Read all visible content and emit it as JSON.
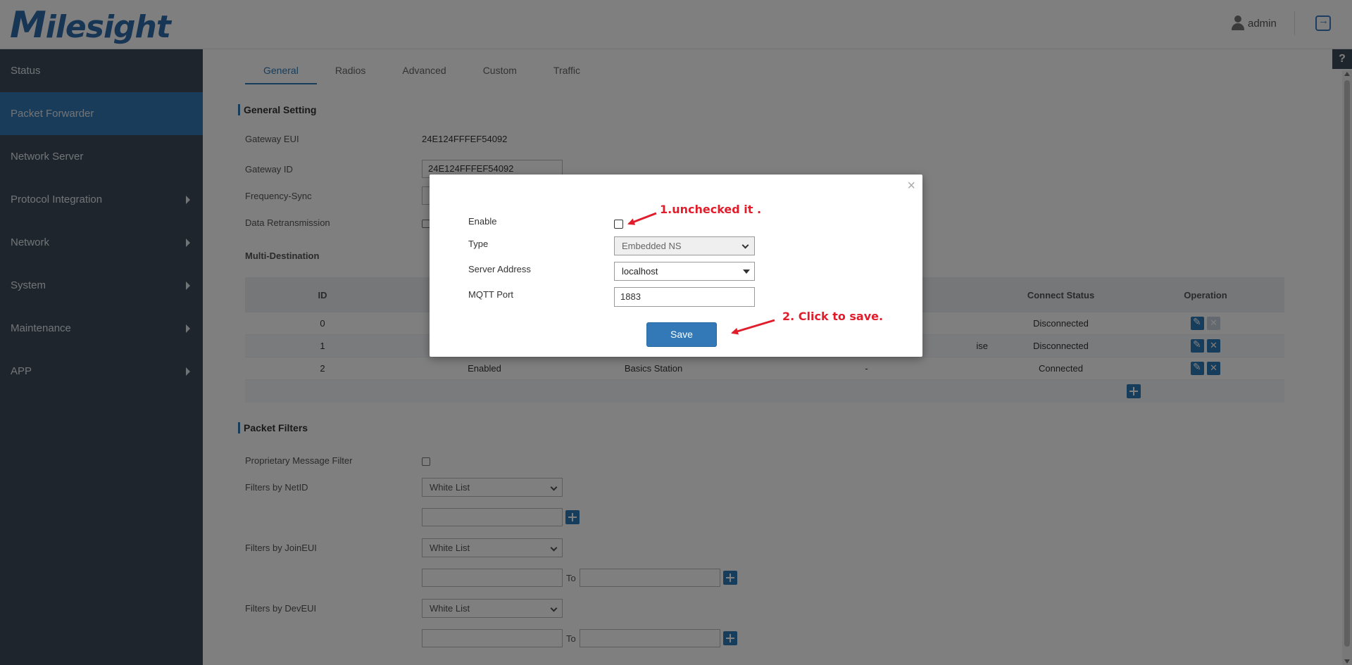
{
  "header": {
    "logo_rest": "ilesight",
    "logo_m": "M",
    "user": "admin"
  },
  "sidebar": {
    "items": [
      {
        "label": "Status",
        "expandable": false
      },
      {
        "label": "Packet Forwarder",
        "expandable": false,
        "active": true
      },
      {
        "label": "Network Server",
        "expandable": false
      },
      {
        "label": "Protocol Integration",
        "expandable": true
      },
      {
        "label": "Network",
        "expandable": true
      },
      {
        "label": "System",
        "expandable": true
      },
      {
        "label": "Maintenance",
        "expandable": true
      },
      {
        "label": "APP",
        "expandable": true
      }
    ]
  },
  "tabs": [
    "General",
    "Radios",
    "Advanced",
    "Custom",
    "Traffic"
  ],
  "general": {
    "section_title": "General Setting",
    "gateway_eui_label": "Gateway EUI",
    "gateway_eui_value": "24E124FFFEF54092",
    "gateway_id_label": "Gateway ID",
    "gateway_id_value": "24E124FFFEF54092",
    "frequency_sync_label": "Frequency-Sync",
    "data_retransmission_label": "Data Retransmission",
    "multi_destination_label": "Multi-Destination"
  },
  "table": {
    "headers": [
      "ID",
      "",
      "",
      "",
      "Connect Status",
      "Operation"
    ],
    "rows": [
      {
        "id": "0",
        "enabled": "",
        "type": "",
        "address": "",
        "status": "Disconnected"
      },
      {
        "id": "1",
        "enabled": "",
        "type": "",
        "address": "ise",
        "status": "Disconnected"
      },
      {
        "id": "2",
        "enabled": "Enabled",
        "type": "Basics Station",
        "address": "-",
        "status": "Connected"
      }
    ]
  },
  "filters": {
    "section_title": "Packet Filters",
    "proprietary_label": "Proprietary Message Filter",
    "netid_label": "Filters by NetID",
    "netid_select": "White List",
    "joineui_label": "Filters by JoinEUI",
    "joineui_select": "White List",
    "deveui_label": "Filters by DevEUI",
    "deveui_select": "White List",
    "to_label": "To"
  },
  "modal": {
    "close": "×",
    "enable_label": "Enable",
    "type_label": "Type",
    "type_value": "Embedded NS",
    "server_address_label": "Server Address",
    "server_address_value": "localhost",
    "mqtt_port_label": "MQTT Port",
    "mqtt_port_value": "1883",
    "save_label": "Save"
  },
  "annotations": {
    "step1": "1.unchecked it .",
    "step2": "2. Click to save."
  },
  "help": "?",
  "colors": {
    "accent": "#3379b7",
    "sidebar": "#3d4b5b",
    "annotation": "#e11d2b"
  }
}
